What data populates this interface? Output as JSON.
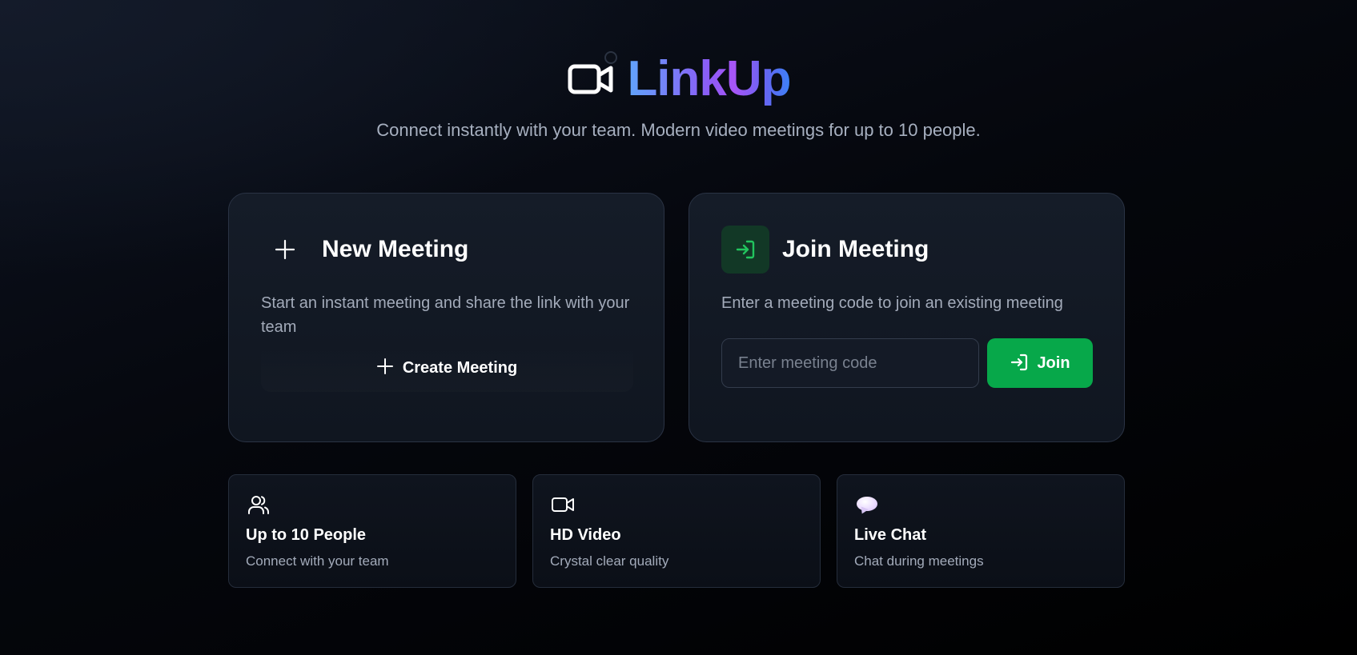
{
  "header": {
    "title": "LinkUp",
    "tagline": "Connect instantly with your team. Modern video meetings for up to 10 people.",
    "logo_icon": "video-camera-icon"
  },
  "new_meeting": {
    "title": "New Meeting",
    "description": "Start an instant meeting and share the link with your team",
    "icon": "plus-icon",
    "button_label": "Create Meeting"
  },
  "join_meeting": {
    "title": "Join Meeting",
    "description": "Enter a meeting code to join an existing meeting",
    "icon": "log-in-icon",
    "input_value": "",
    "input_placeholder": "Enter meeting code",
    "button_label": "Join"
  },
  "features": [
    {
      "icon": "users-icon",
      "title": "Up to 10 People",
      "description": "Connect with your team"
    },
    {
      "icon": "video-camera-icon",
      "title": "HD Video",
      "description": "Crystal clear quality"
    },
    {
      "icon": "speech-bubble-icon",
      "title": "Live Chat",
      "description": "Chat during meetings"
    }
  ],
  "colors": {
    "accent_green": "#07a84a",
    "join_icon_bg": "#123826",
    "join_icon_fg": "#22c55e",
    "brand_gradient_start": "#60a5fa",
    "brand_gradient_mid": "#a855f7",
    "brand_gradient_end": "#3b82f6",
    "card_border": "#2a3344",
    "muted_text": "#a3abba"
  }
}
